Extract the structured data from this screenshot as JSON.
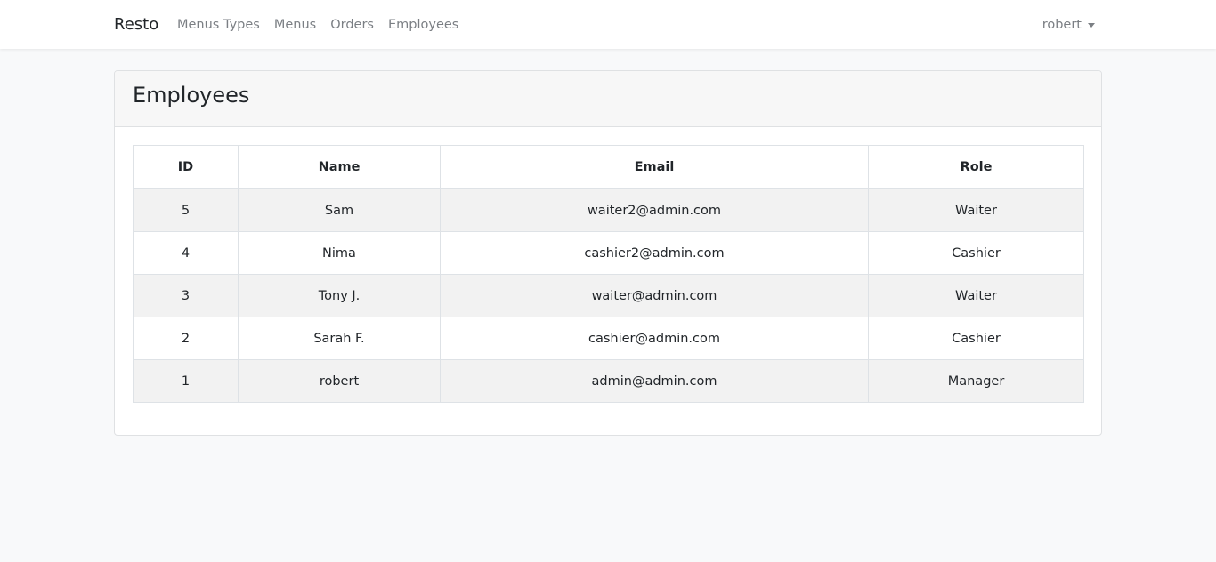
{
  "navbar": {
    "brand": "Resto",
    "links": [
      "Menus Types",
      "Menus",
      "Orders",
      "Employees"
    ],
    "user": "robert"
  },
  "page": {
    "title": "Employees"
  },
  "table": {
    "headers": [
      "ID",
      "Name",
      "Email",
      "Role"
    ],
    "rows": [
      [
        "5",
        "Sam",
        "waiter2@admin.com",
        "Waiter"
      ],
      [
        "4",
        "Nima",
        "cashier2@admin.com",
        "Cashier"
      ],
      [
        "3",
        "Tony J.",
        "waiter@admin.com",
        "Waiter"
      ],
      [
        "2",
        "Sarah F.",
        "cashier@admin.com",
        "Cashier"
      ],
      [
        "1",
        "robert",
        "admin@admin.com",
        "Manager"
      ]
    ]
  }
}
